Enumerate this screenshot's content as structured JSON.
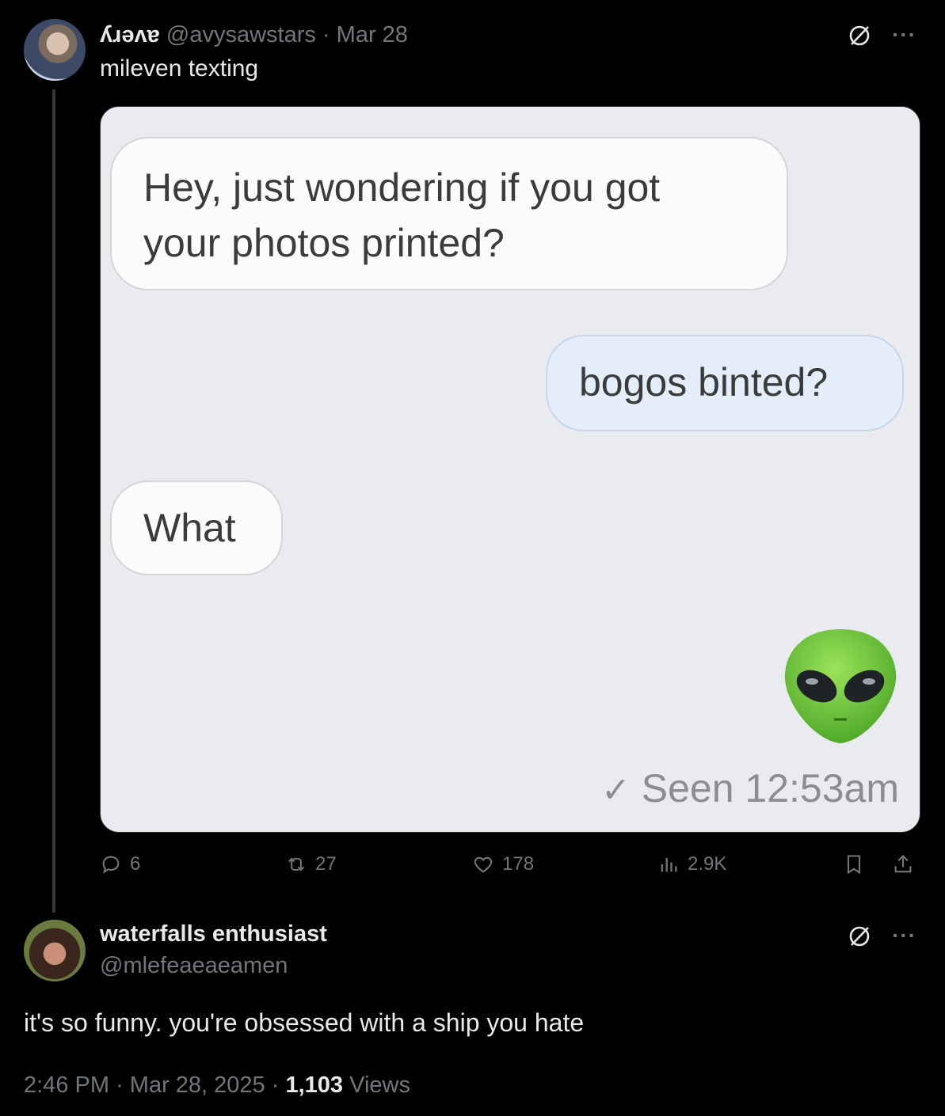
{
  "tweet": {
    "display_name": "ʎɹəʌɐ",
    "handle": "@avysawstars",
    "separator": "·",
    "date": "Mar 28",
    "text": "mileven texting",
    "media": {
      "messages": [
        {
          "side": "left",
          "lines": [
            "Hey, just wondering if you got",
            "your photos printed?"
          ]
        },
        {
          "side": "right",
          "lines": [
            "bogos binted?"
          ]
        },
        {
          "side": "left",
          "lines": [
            "What"
          ]
        },
        {
          "side": "right",
          "emoji": "alien"
        }
      ],
      "seen_text": "Seen 12:53am"
    },
    "stats": {
      "replies": "6",
      "reposts": "27",
      "likes": "178",
      "views": "2.9K"
    }
  },
  "reply": {
    "display_name": "waterfalls enthusiast",
    "handle": "@mlefeaeaeamen",
    "text": "it's so funny. you're obsessed with a ship you hate",
    "time": "2:46 PM",
    "date": "Mar 28, 2025",
    "separator": "·",
    "views_count": "1,103",
    "views_label": "Views"
  },
  "icons": {
    "grok": "grok-icon",
    "more": "more-icon",
    "reply": "reply-icon",
    "repost": "repost-icon",
    "like": "like-icon",
    "views": "views-icon",
    "bookmark": "bookmark-icon",
    "share": "share-icon"
  },
  "more_glyph": "···",
  "colors": {
    "background": "#000000",
    "text": "#e7e9ea",
    "muted": "#71767b",
    "divider": "#333639"
  }
}
